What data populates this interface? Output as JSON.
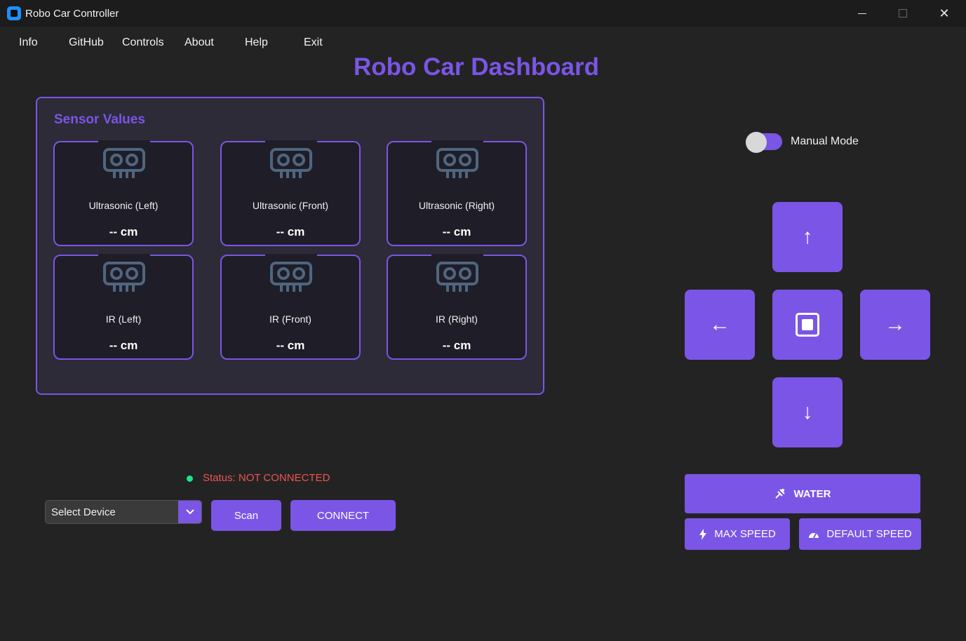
{
  "window": {
    "title": "Robo Car Controller",
    "minimize_symbol": "—",
    "close_symbol": "✕"
  },
  "menu": {
    "items": [
      "Info",
      "GitHub",
      "Controls",
      "About",
      "Help",
      "Exit"
    ]
  },
  "dashboard": {
    "title": "Robo Car Dashboard"
  },
  "sensors": {
    "title": "Sensor Values",
    "icon": "sensor-icon",
    "cards": [
      {
        "name": "Ultrasonic (Left)",
        "value": "-- cm"
      },
      {
        "name": "Ultrasonic (Front)",
        "value": "-- cm"
      },
      {
        "name": "Ultrasonic (Right)",
        "value": "-- cm"
      },
      {
        "name": "IR (Left)",
        "value": "-- cm"
      },
      {
        "name": "IR (Front)",
        "value": "-- cm"
      },
      {
        "name": "IR (Right)",
        "value": "-- cm"
      }
    ]
  },
  "mode": {
    "label": "Manual Mode",
    "enabled": false
  },
  "controls": {
    "up": "↑",
    "down": "↓",
    "left": "←",
    "right": "→",
    "stop_icon": "stop-icon"
  },
  "actions": {
    "water": "WATER",
    "max_speed": "MAX SPEED",
    "default_speed": "DEFAULT SPEED"
  },
  "connection": {
    "status": "Status: NOT CONNECTED",
    "device_placeholder": "Select Device",
    "scan": "Scan",
    "connect": "CONNECT"
  },
  "colors": {
    "accent": "#7b55e6",
    "background": "#232323",
    "status_dot": "#17e68a",
    "status_text": "#ef5350"
  }
}
